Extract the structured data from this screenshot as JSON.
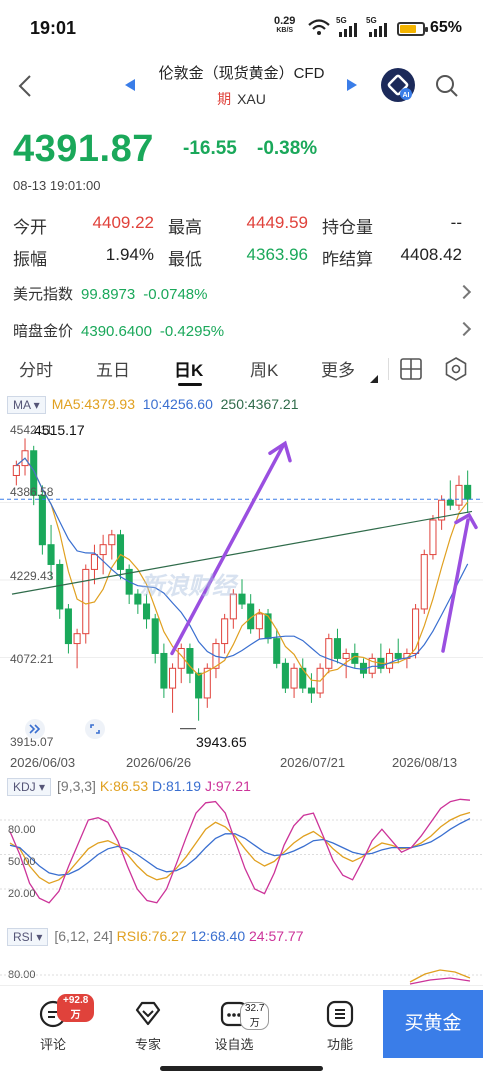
{
  "status_bar": {
    "time": "19:01",
    "net_speed_value": "0.29",
    "net_speed_unit": "KB/S",
    "signal1": "5G",
    "signal2": "5G",
    "battery": "65%",
    "battery_level": 0.65
  },
  "header": {
    "title": "伦敦金（现货黄金）CFD",
    "tag": "期",
    "symbol": "XAU"
  },
  "quote": {
    "price": "4391.87",
    "change": "-16.55",
    "change_pct": "-0.38%",
    "timestamp": "08-13 19:01:00",
    "open_label": "今开",
    "open": "4409.22",
    "high_label": "最高",
    "high": "4449.59",
    "oi_label": "持仓量",
    "oi": "--",
    "amp_label": "振幅",
    "amp": "1.94%",
    "low_label": "最低",
    "low": "4363.96",
    "settle_label": "昨结算",
    "settle": "4408.42"
  },
  "related": [
    {
      "label": "美元指数",
      "value": "99.8973",
      "change": "-0.0748%"
    },
    {
      "label": "暗盘金价",
      "value": "4390.6400",
      "change": "-0.4295%"
    }
  ],
  "tabs": [
    "分时",
    "五日",
    "日K",
    "周K",
    "更多"
  ],
  "active_tab": "日K",
  "ma": {
    "name": "MA",
    "ma5": "MA5:4379.93",
    "ma10": "10:4256.60",
    "ma250": "250:4367.21"
  },
  "price_axis": [
    "4542.11",
    "4386.58",
    "4229.43",
    "4072.21",
    "3915.07"
  ],
  "annotations": {
    "max": "4515.17",
    "min": "3943.65"
  },
  "dates": [
    "2026/06/03",
    "2026/06/26",
    "2026/07/21",
    "2026/08/13"
  ],
  "watermark": "新浪财经",
  "kdj": {
    "name": "KDJ",
    "params": "[9,3,3]",
    "k": "K:86.53",
    "d": "D:81.19",
    "j": "J:97.21",
    "axis": [
      "80.00",
      "50.00",
      "20.00"
    ]
  },
  "rsi": {
    "name": "RSI",
    "params": "[6,12, 24]",
    "r6": "RSI6:76.27",
    "r12": "12:68.40",
    "r24": "24:57.77",
    "axis": [
      "80.00"
    ]
  },
  "nav": [
    {
      "label": "评论",
      "badge": "+92.8万",
      "icon": "comment-icon"
    },
    {
      "label": "专家",
      "icon": "expert-icon"
    },
    {
      "label": "设自选",
      "badge": "32.7万",
      "icon": "watchlist-icon"
    },
    {
      "label": "功能",
      "icon": "function-icon"
    }
  ],
  "buy_button": "买黄金",
  "colors": {
    "up": "#e0423b",
    "down": "#1aa85a",
    "ma5": "#e0a020",
    "ma10": "#3a6fd0",
    "ma250": "#2f6b4a",
    "k": "#e0a020",
    "d": "#3a6fd0",
    "j": "#cc3399",
    "accent": "#3a7de8",
    "arrow": "#9a4fe0"
  },
  "chart_data": [
    {
      "type": "candlestick",
      "title": "",
      "x_range": [
        "2026/06/03",
        "2026/08/13"
      ],
      "ylim": [
        3915.07,
        4542.11
      ],
      "ohlc": [
        [
          4440,
          4470,
          4420,
          4460
        ],
        [
          4460,
          4515,
          4440,
          4490
        ],
        [
          4490,
          4500,
          4380,
          4400
        ],
        [
          4400,
          4420,
          4280,
          4300
        ],
        [
          4300,
          4340,
          4230,
          4260
        ],
        [
          4260,
          4270,
          4150,
          4170
        ],
        [
          4170,
          4180,
          4080,
          4100
        ],
        [
          4100,
          4130,
          4050,
          4120
        ],
        [
          4120,
          4260,
          4100,
          4250
        ],
        [
          4250,
          4300,
          4220,
          4280
        ],
        [
          4280,
          4320,
          4240,
          4300
        ],
        [
          4300,
          4330,
          4270,
          4320
        ],
        [
          4320,
          4330,
          4230,
          4250
        ],
        [
          4250,
          4260,
          4180,
          4200
        ],
        [
          4200,
          4210,
          4160,
          4180
        ],
        [
          4180,
          4200,
          4130,
          4150
        ],
        [
          4150,
          4160,
          4060,
          4080
        ],
        [
          4080,
          4100,
          3990,
          4010
        ],
        [
          4010,
          4060,
          3960,
          4050
        ],
        [
          4050,
          4100,
          4020,
          4090
        ],
        [
          4090,
          4100,
          4020,
          4040
        ],
        [
          4040,
          4050,
          3944,
          3990
        ],
        [
          3990,
          4060,
          3970,
          4050
        ],
        [
          4050,
          4110,
          4030,
          4100
        ],
        [
          4100,
          4160,
          4080,
          4150
        ],
        [
          4150,
          4210,
          4130,
          4200
        ],
        [
          4200,
          4230,
          4170,
          4180
        ],
        [
          4180,
          4200,
          4120,
          4130
        ],
        [
          4130,
          4170,
          4110,
          4160
        ],
        [
          4160,
          4170,
          4100,
          4110
        ],
        [
          4110,
          4130,
          4050,
          4060
        ],
        [
          4060,
          4070,
          4000,
          4010
        ],
        [
          4010,
          4060,
          3990,
          4050
        ],
        [
          4050,
          4070,
          4000,
          4010
        ],
        [
          4010,
          4040,
          3980,
          4000
        ],
        [
          4000,
          4060,
          3990,
          4050
        ],
        [
          4050,
          4120,
          4040,
          4110
        ],
        [
          4110,
          4130,
          4060,
          4070
        ],
        [
          4070,
          4090,
          4030,
          4080
        ],
        [
          4080,
          4100,
          4050,
          4060
        ],
        [
          4060,
          4070,
          4030,
          4040
        ],
        [
          4040,
          4080,
          4030,
          4070
        ],
        [
          4070,
          4100,
          4040,
          4050
        ],
        [
          4050,
          4090,
          4040,
          4080
        ],
        [
          4080,
          4110,
          4060,
          4070
        ],
        [
          4070,
          4090,
          4050,
          4080
        ],
        [
          4080,
          4180,
          4070,
          4170
        ],
        [
          4170,
          4290,
          4160,
          4280
        ],
        [
          4280,
          4360,
          4270,
          4350
        ],
        [
          4350,
          4400,
          4330,
          4390
        ],
        [
          4390,
          4430,
          4370,
          4380
        ],
        [
          4380,
          4440,
          4370,
          4420
        ],
        [
          4420,
          4450,
          4364,
          4392
        ]
      ],
      "ma5_last": 4379.93,
      "ma10_last": 4256.6,
      "ma250_last": 4367.21
    },
    {
      "type": "line",
      "title": "KDJ",
      "ylim": [
        0,
        100
      ],
      "series": [
        {
          "name": "K",
          "values": [
            60,
            55,
            40,
            30,
            25,
            28,
            35,
            45,
            55,
            60,
            62,
            58,
            50,
            40,
            32,
            28,
            30,
            38,
            48,
            60,
            72,
            78,
            74,
            66,
            55,
            45,
            40,
            44,
            52,
            60,
            66,
            70,
            64,
            55,
            48,
            44,
            48,
            55,
            60,
            58,
            55,
            56,
            60,
            66,
            74,
            80,
            84,
            86.53
          ]
        },
        {
          "name": "D",
          "values": [
            58,
            56,
            48,
            40,
            34,
            32,
            33,
            37,
            43,
            50,
            55,
            57,
            55,
            50,
            44,
            38,
            35,
            36,
            40,
            47,
            56,
            64,
            68,
            68,
            64,
            58,
            52,
            49,
            50,
            53,
            57,
            62,
            63,
            60,
            56,
            52,
            50,
            51,
            54,
            56,
            56,
            56,
            58,
            61,
            66,
            72,
            77,
            81.19
          ]
        },
        {
          "name": "J",
          "values": [
            70,
            50,
            25,
            12,
            8,
            18,
            40,
            60,
            80,
            82,
            78,
            62,
            40,
            20,
            10,
            8,
            20,
            42,
            65,
            86,
            95,
            96,
            86,
            62,
            38,
            20,
            16,
            34,
            58,
            75,
            84,
            86,
            66,
            45,
            32,
            28,
            44,
            62,
            72,
            62,
            52,
            56,
            66,
            78,
            90,
            96,
            98,
            97.21
          ]
        }
      ]
    },
    {
      "type": "line",
      "title": "RSI",
      "series": [
        {
          "name": "RSI6",
          "values": [
            76.27
          ]
        },
        {
          "name": "12",
          "values": [
            68.4
          ]
        },
        {
          "name": "24",
          "values": [
            57.77
          ]
        }
      ]
    }
  ]
}
